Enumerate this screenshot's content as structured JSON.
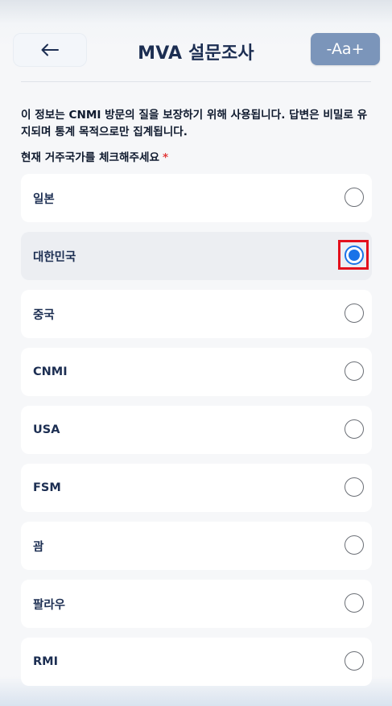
{
  "header": {
    "title": "MVA 설문조사",
    "back_icon": "arrow-left-icon",
    "font_size_label": "-Aa+"
  },
  "intro_text": "이 정보는 CNMI 방문의 질을 보장하기 위해 사용됩니다. 답변은 비밀로 유지되며 통계 목적으로만 집계됩니다.",
  "question": {
    "label": "현재 거주국가를 체크해주세요",
    "required_mark": "*"
  },
  "options": [
    {
      "label": "일본",
      "selected": false
    },
    {
      "label": "대한민국",
      "selected": true
    },
    {
      "label": "중국",
      "selected": false
    },
    {
      "label": "CNMI",
      "selected": false
    },
    {
      "label": "USA",
      "selected": false
    },
    {
      "label": "FSM",
      "selected": false
    },
    {
      "label": "괌",
      "selected": false
    },
    {
      "label": "팔라우",
      "selected": false
    },
    {
      "label": "RMI",
      "selected": false
    }
  ],
  "colors": {
    "accent": "#1a73e8",
    "title": "#1c2e52",
    "font_button": "#7b95ba",
    "required": "#e23b3b",
    "highlight": "#e3101c"
  }
}
